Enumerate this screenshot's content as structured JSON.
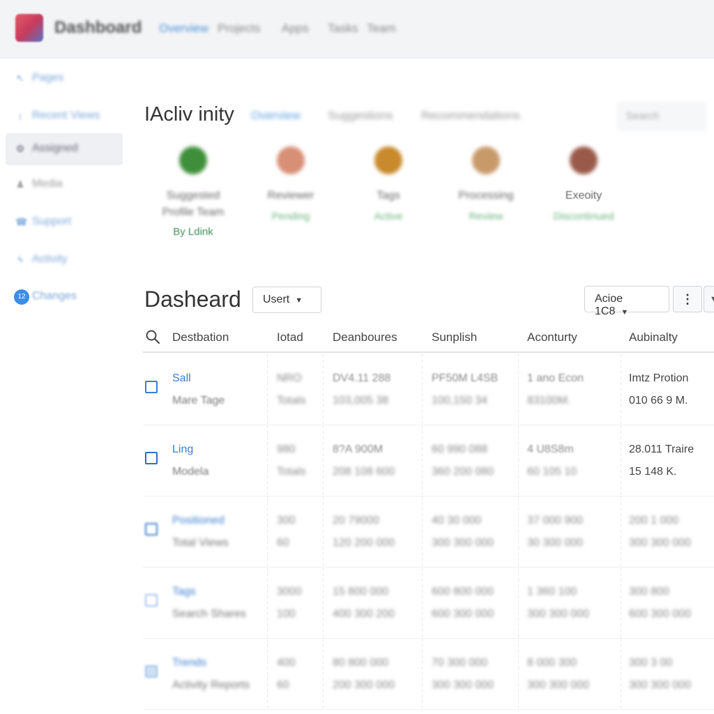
{
  "header": {
    "brand": "Dashboard",
    "nav": [
      "Overview",
      "Projects",
      "Apps",
      "Tasks",
      "Team"
    ],
    "active_index": 0
  },
  "sidebar": {
    "items": [
      {
        "label": "Pages",
        "icon": "pin-icon"
      },
      {
        "label": "Recent Views",
        "icon": "clock-icon"
      },
      {
        "label": "Assigned",
        "icon": "gear-icon"
      },
      {
        "label": "Media",
        "icon": "user-icon"
      },
      {
        "label": "Support",
        "icon": "phone-icon"
      },
      {
        "label": "Activity",
        "icon": "bolt-icon"
      },
      {
        "label": "Changes",
        "icon": "badge-icon",
        "badge": "12"
      }
    ],
    "selected_index": 2
  },
  "activity": {
    "title": "IAcliv inity",
    "tabs": [
      "Overview",
      "Suggestions",
      "Recommendations"
    ],
    "search_placeholder": "Search",
    "people": [
      {
        "name": "Suggested",
        "name2": "Profile Team",
        "sub": "By Ldink",
        "avatar_color": "#3f8f3a"
      },
      {
        "name": "Reviewer",
        "sub": "Pending",
        "avatar_color": "#d78f76"
      },
      {
        "name": "Tags",
        "sub": "Active",
        "avatar_color": "#c88a2c"
      },
      {
        "name": "Processing",
        "sub": "Review",
        "avatar_color": "#c89a6a"
      },
      {
        "name": "Exeoity",
        "sub": "Discontinued",
        "avatar_color": "#9a5a4a"
      }
    ]
  },
  "dashboard": {
    "title": "Dasheard",
    "filter_label": "Usert",
    "sort_label": "Acioe 1C8"
  },
  "table": {
    "columns": [
      "Destbation",
      "Iotad",
      "Deanboures",
      "Sunplish",
      "Aconturty",
      "Aubinalty"
    ],
    "rows": [
      {
        "name": "Sall",
        "sub": "Mare Tage",
        "c2": [
          "NRO",
          "Totals"
        ],
        "c3": [
          "DV4.11 288",
          "103,005 38"
        ],
        "c4": [
          "PF50M L4SB",
          "100,150 34"
        ],
        "c5": [
          "1 ano Econ",
          "83100M."
        ],
        "c6": [
          "Imtz Protion",
          "010 66 9 M."
        ]
      },
      {
        "name": "Ling",
        "sub": "Modela",
        "c2": [
          "980",
          "Totals"
        ],
        "c3": [
          "8?A 900M",
          "208 108 600"
        ],
        "c4": [
          "60 990 088",
          "360 200 080"
        ],
        "c5": [
          "4 U8S8m",
          "60 105 10"
        ],
        "c6": [
          "28.011 Traire",
          "15 148 K."
        ]
      },
      {
        "name": "Positioned",
        "sub": "Total Views",
        "c2": [
          "300",
          "60"
        ],
        "c3": [
          "20 79000",
          "120 200 000"
        ],
        "c4": [
          "40 30 000",
          "300 300 000"
        ],
        "c5": [
          "37 000 900",
          "30 300 000"
        ],
        "c6": [
          "200 1 000",
          "300 300 000"
        ]
      },
      {
        "name": "Tags",
        "sub": "Search Shares",
        "c2": [
          "3000",
          "100"
        ],
        "c3": [
          "15 800 000",
          "400 300 200"
        ],
        "c4": [
          "600 800 000",
          "600 300 000"
        ],
        "c5": [
          "1 360 100",
          "300 300 000"
        ],
        "c6": [
          "300 800",
          "600 300 000"
        ]
      },
      {
        "name": "Trends",
        "sub": "Activity Reports",
        "c2": [
          "400",
          "60"
        ],
        "c3": [
          "80 800 000",
          "200 300 000"
        ],
        "c4": [
          "70 300 000",
          "300 300 000"
        ],
        "c5": [
          "8 000 300",
          "300 300 000"
        ],
        "c6": [
          "300 3 00",
          "300 300 000"
        ]
      }
    ]
  }
}
